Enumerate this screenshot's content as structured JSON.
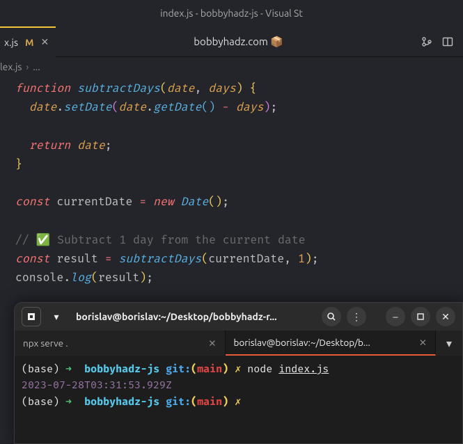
{
  "window": {
    "title": "index.js - bobbyhadz-js - Visual St"
  },
  "center_title": "bobbyhadz.com 📦",
  "tab": {
    "name": "x.js",
    "modified": "M"
  },
  "breadcrumb": {
    "file": "lex.js",
    "rest": "..."
  },
  "code": {
    "l1": {
      "kw": "function",
      "fn": "subtractDays",
      "p1": "date",
      "p2": "days"
    },
    "l2": {
      "obj": "date",
      "m1": "setDate",
      "obj2": "date",
      "m2": "getDate",
      "arg": "days"
    },
    "l3": {
      "kw": "return",
      "v": "date"
    },
    "l4": {
      "kw": "const",
      "name": "currentDate",
      "new": "new",
      "cls": "Date"
    },
    "l5": {
      "comment": "// ✅ Subtract 1 day from the current date"
    },
    "l6": {
      "kw": "const",
      "name": "result",
      "fn": "subtractDays",
      "a1": "currentDate",
      "a2": "1"
    },
    "l7": {
      "obj": "console",
      "m": "log",
      "a": "result"
    }
  },
  "terminal": {
    "path": "borislav@borislav:~/Desktop/bobbyhadz-r...",
    "tab1": "npx serve .",
    "tab2": "borislav@borislav:~/Desktop/b...",
    "line1": {
      "base": "(base)",
      "arrow": "➜",
      "dir": "bobbyhadz-js",
      "git": "git:",
      "lp": "(",
      "branch": "main",
      "rp": ")",
      "x": "✗",
      "node": "node",
      "file": "index.js"
    },
    "timestamp": "2023-07-28T03:31:53.929Z",
    "line2": {
      "base": "(base)",
      "arrow": "➜",
      "dir": "bobbyhadz-js",
      "git": "git:",
      "lp": "(",
      "branch": "main",
      "rp": ")",
      "x": "✗"
    }
  }
}
